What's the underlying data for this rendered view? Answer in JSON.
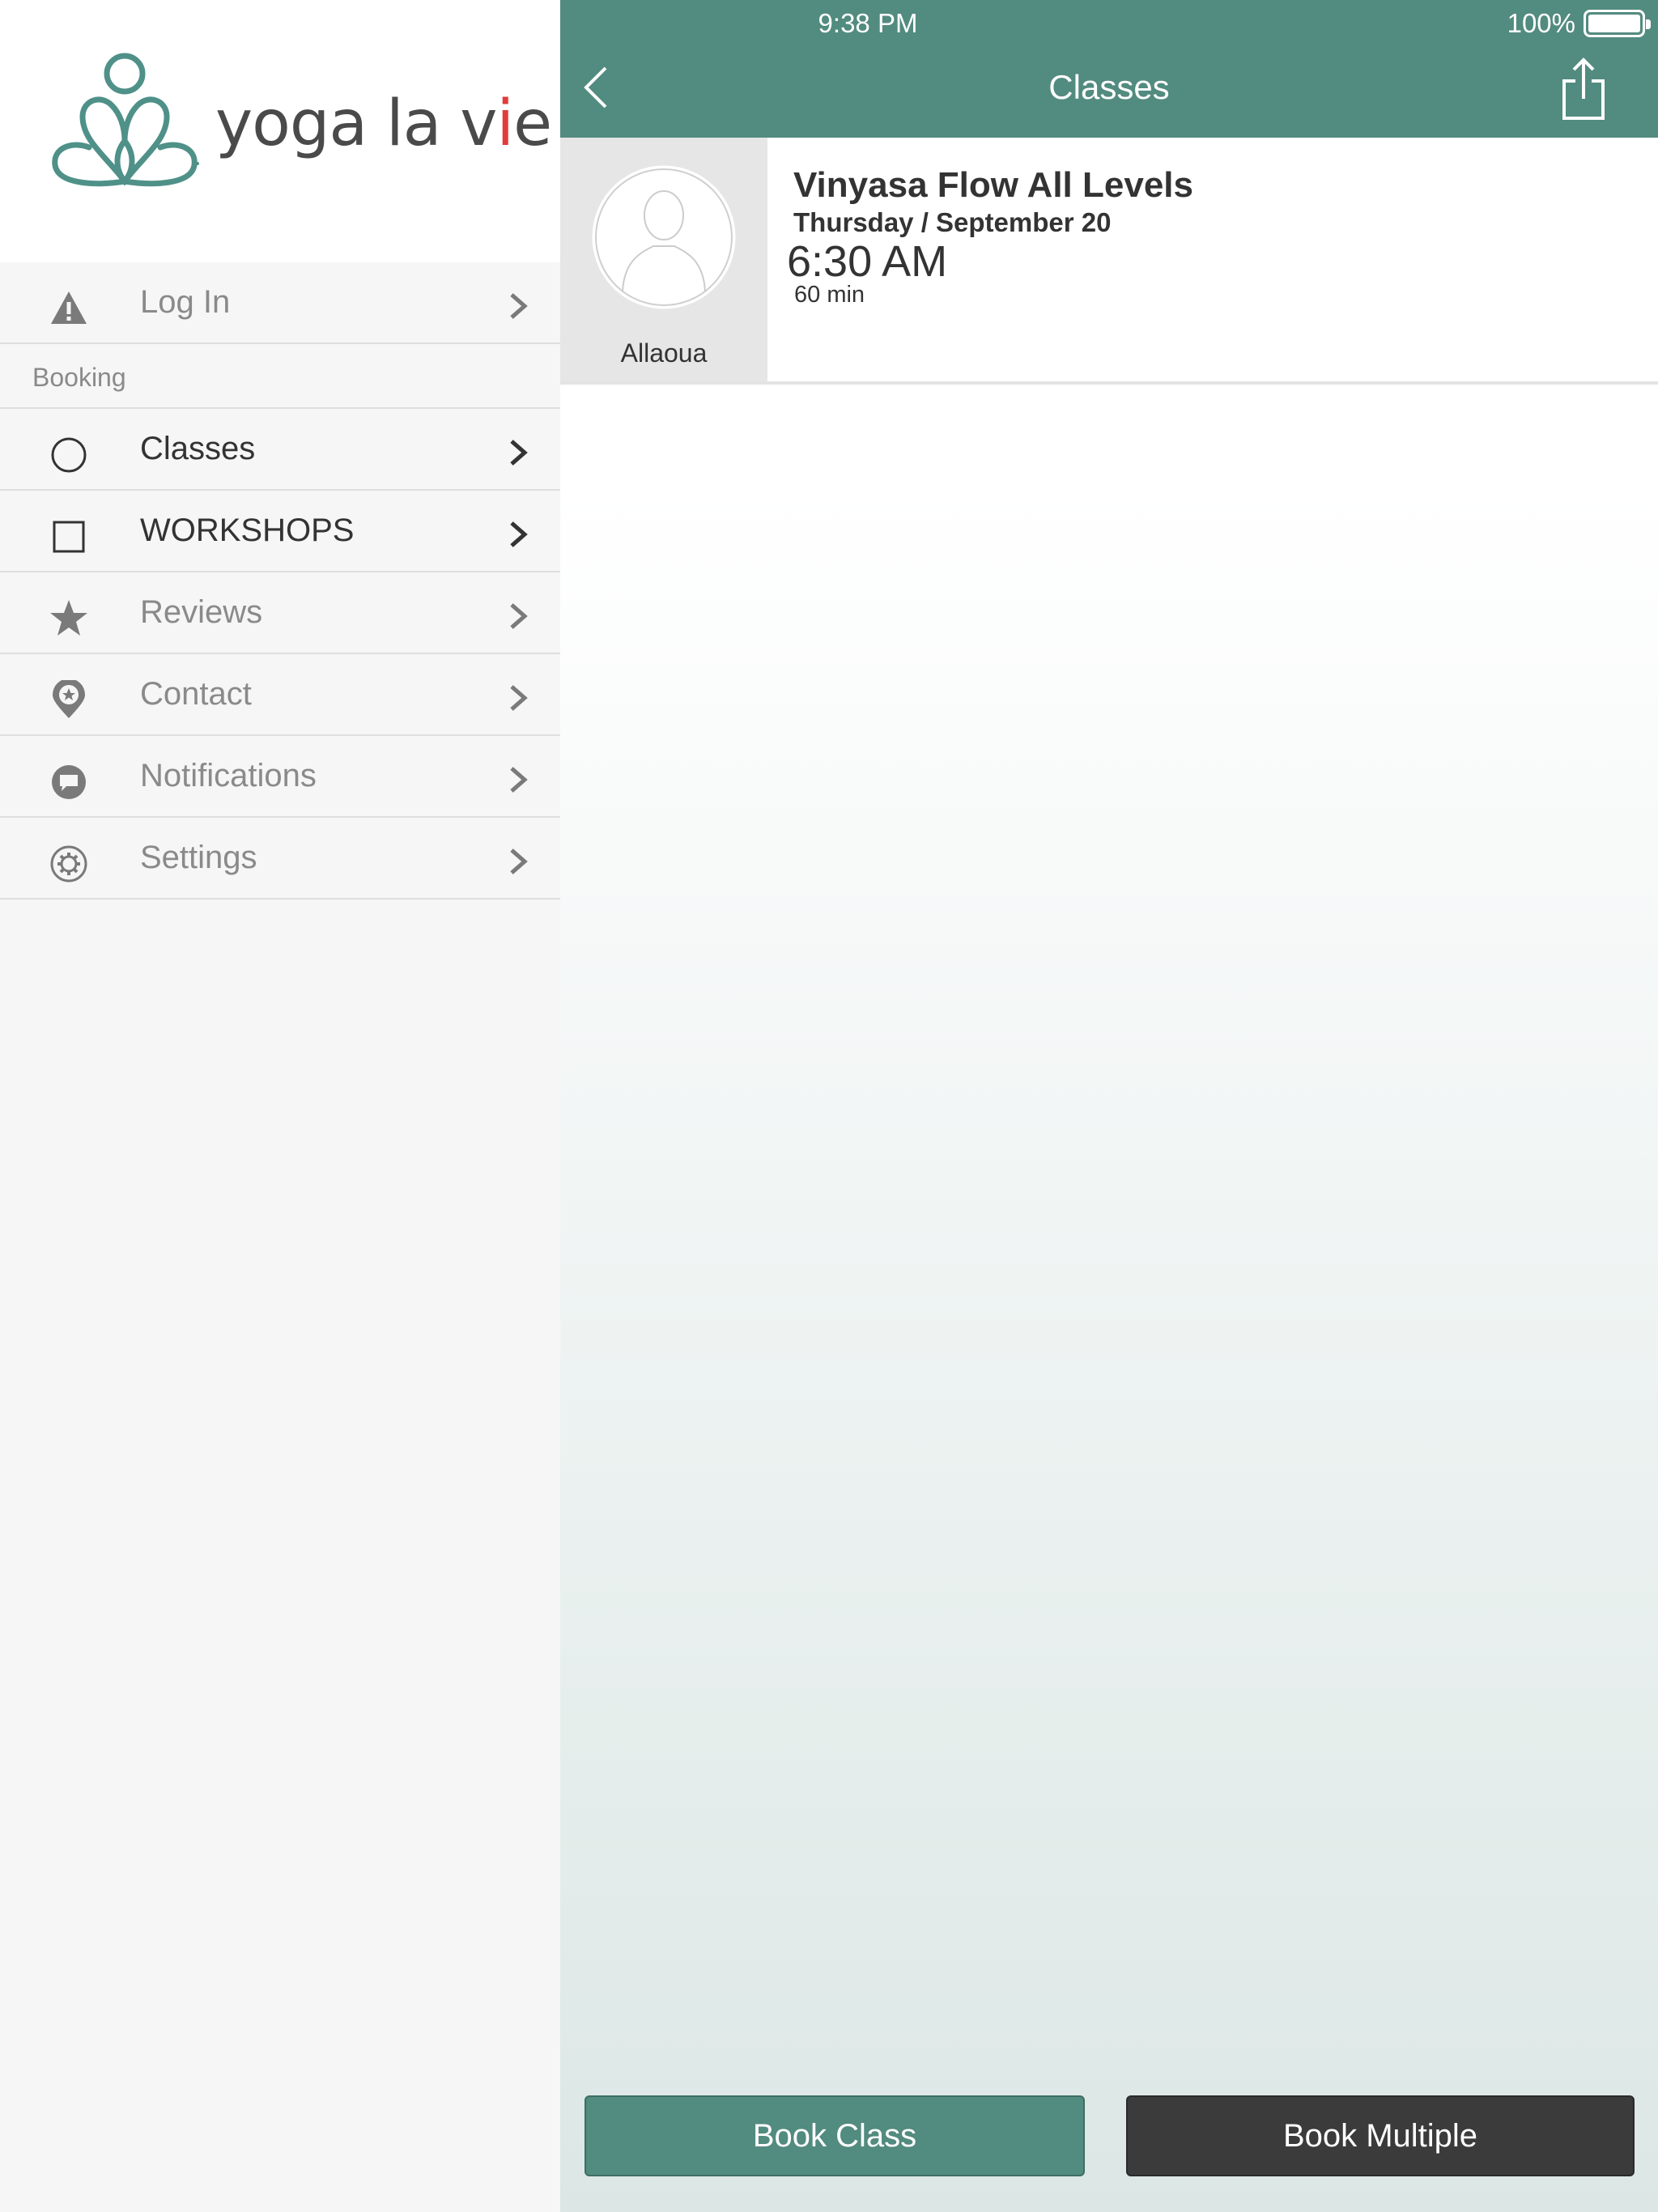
{
  "status_bar": {
    "time": "9:38 PM",
    "battery": "100%"
  },
  "logo": {
    "text_prefix": "yoga la v",
    "text_accent": "i",
    "text_suffix": "e"
  },
  "sidebar": {
    "login": {
      "label": "Log In",
      "icon": "warning-icon"
    },
    "section": "Booking",
    "items": [
      {
        "label": "Classes",
        "icon": "circle-icon",
        "active": true
      },
      {
        "label": "WORKSHOPS",
        "icon": "square-icon",
        "active": true
      },
      {
        "label": "Reviews",
        "icon": "star-icon",
        "active": false
      },
      {
        "label": "Contact",
        "icon": "map-pin-icon",
        "active": false
      },
      {
        "label": "Notifications",
        "icon": "chat-bubble-icon",
        "active": false
      },
      {
        "label": "Settings",
        "icon": "gear-icon",
        "active": false
      }
    ]
  },
  "header": {
    "title": "Classes"
  },
  "class_item": {
    "instructor": "Allaoua",
    "name": "Vinyasa Flow All Levels",
    "date": "Thursday / September 20",
    "time": "6:30 AM",
    "duration": "60 min"
  },
  "actions": {
    "book": "Book Class",
    "book_multiple": "Book Multiple"
  },
  "colors": {
    "brand": "#528b7f",
    "dark_button": "#3b3b3b",
    "accent_dot": "#e23b3b"
  }
}
